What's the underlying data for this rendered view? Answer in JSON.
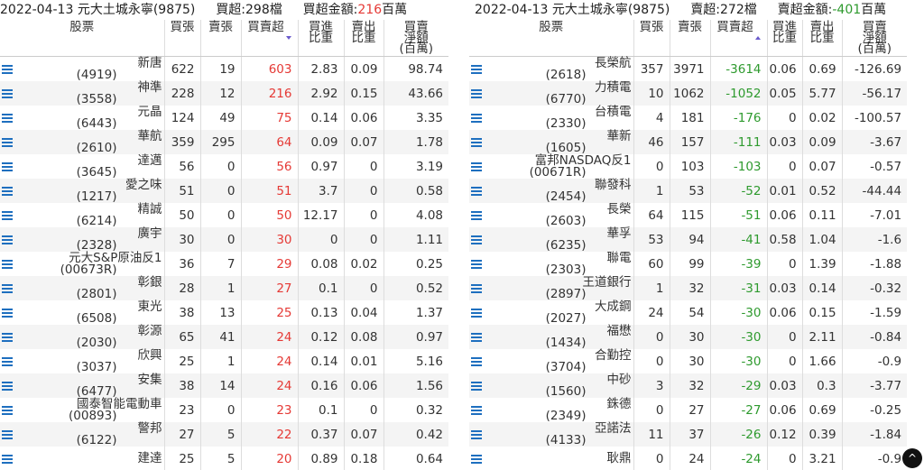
{
  "left": {
    "date": "2022-04-13",
    "broker": "元大土城永寧(9875)",
    "count_label": "買超:298檔",
    "amount_label": "買超金額:",
    "amount_value": "216",
    "amount_unit": "百萬",
    "headers": [
      "股票",
      "買張",
      "賣張",
      "買賣超",
      "買進\n比重",
      "賣出\n比重",
      "買賣\n淨額\n(百萬)"
    ],
    "rows": [
      {
        "name": "新唐",
        "code": "(4919)",
        "buy": "622",
        "sell": "19",
        "net": "603",
        "bp": "2.83",
        "sp": "0.09",
        "amt": "98.74"
      },
      {
        "name": "神準",
        "code": "(3558)",
        "buy": "228",
        "sell": "12",
        "net": "216",
        "bp": "2.92",
        "sp": "0.15",
        "amt": "43.66"
      },
      {
        "name": "元晶",
        "code": "(6443)",
        "buy": "124",
        "sell": "49",
        "net": "75",
        "bp": "0.14",
        "sp": "0.06",
        "amt": "3.35"
      },
      {
        "name": "華航",
        "code": "(2610)",
        "buy": "359",
        "sell": "295",
        "net": "64",
        "bp": "0.09",
        "sp": "0.07",
        "amt": "1.78"
      },
      {
        "name": "達邁",
        "code": "(3645)",
        "buy": "56",
        "sell": "0",
        "net": "56",
        "bp": "0.97",
        "sp": "0",
        "amt": "3.19"
      },
      {
        "name": "愛之味",
        "code": "(1217)",
        "buy": "51",
        "sell": "0",
        "net": "51",
        "bp": "3.7",
        "sp": "0",
        "amt": "0.58"
      },
      {
        "name": "精誠",
        "code": "(6214)",
        "buy": "50",
        "sell": "0",
        "net": "50",
        "bp": "12.17",
        "sp": "0",
        "amt": "4.08"
      },
      {
        "name": "廣宇",
        "code": "(2328)",
        "buy": "30",
        "sell": "0",
        "net": "30",
        "bp": "0",
        "sp": "0",
        "amt": "1.11"
      },
      {
        "name": "元大S&P原油反1",
        "code": "(00673R)",
        "buy": "36",
        "sell": "7",
        "net": "29",
        "bp": "0.08",
        "sp": "0.02",
        "amt": "0.25"
      },
      {
        "name": "彰銀",
        "code": "(2801)",
        "buy": "28",
        "sell": "1",
        "net": "27",
        "bp": "0.1",
        "sp": "0",
        "amt": "0.52"
      },
      {
        "name": "東光",
        "code": "(6508)",
        "buy": "38",
        "sell": "13",
        "net": "25",
        "bp": "0.13",
        "sp": "0.04",
        "amt": "1.37"
      },
      {
        "name": "彰源",
        "code": "(2030)",
        "buy": "65",
        "sell": "41",
        "net": "24",
        "bp": "0.12",
        "sp": "0.08",
        "amt": "0.97"
      },
      {
        "name": "欣興",
        "code": "(3037)",
        "buy": "25",
        "sell": "1",
        "net": "24",
        "bp": "0.14",
        "sp": "0.01",
        "amt": "5.16"
      },
      {
        "name": "安集",
        "code": "(6477)",
        "buy": "38",
        "sell": "14",
        "net": "24",
        "bp": "0.16",
        "sp": "0.06",
        "amt": "1.56"
      },
      {
        "name": "國泰智能電動車",
        "code": "(00893)",
        "buy": "23",
        "sell": "0",
        "net": "23",
        "bp": "0.1",
        "sp": "0",
        "amt": "0.32"
      },
      {
        "name": "警邦",
        "code": "(6122)",
        "buy": "27",
        "sell": "5",
        "net": "22",
        "bp": "0.37",
        "sp": "0.07",
        "amt": "0.42"
      },
      {
        "name": "建達",
        "code": "",
        "buy": "25",
        "sell": "5",
        "net": "20",
        "bp": "0.89",
        "sp": "0.18",
        "amt": "0.64"
      }
    ]
  },
  "right": {
    "date": "2022-04-13",
    "broker": "元大土城永寧(9875)",
    "count_label": "賣超:272檔",
    "amount_label": "賣超金額:",
    "amount_value": "-401",
    "amount_unit": "百萬",
    "headers": [
      "股票",
      "買張",
      "賣張",
      "買賣超",
      "買進\n比重",
      "賣出\n比重",
      "買賣\n淨額\n(百萬)"
    ],
    "rows": [
      {
        "name": "長榮航",
        "code": "(2618)",
        "buy": "357",
        "sell": "3971",
        "net": "-3614",
        "bp": "0.06",
        "sp": "0.69",
        "amt": "-126.69"
      },
      {
        "name": "力積電",
        "code": "(6770)",
        "buy": "10",
        "sell": "1062",
        "net": "-1052",
        "bp": "0.05",
        "sp": "5.77",
        "amt": "-56.17"
      },
      {
        "name": "台積電",
        "code": "(2330)",
        "buy": "4",
        "sell": "181",
        "net": "-176",
        "bp": "0",
        "sp": "0.02",
        "amt": "-100.57"
      },
      {
        "name": "華新",
        "code": "(1605)",
        "buy": "46",
        "sell": "157",
        "net": "-111",
        "bp": "0.03",
        "sp": "0.09",
        "amt": "-3.67"
      },
      {
        "name": "富邦NASDAQ反1",
        "code": "(00671R)",
        "buy": "0",
        "sell": "103",
        "net": "-103",
        "bp": "0",
        "sp": "0.07",
        "amt": "-0.57"
      },
      {
        "name": "聯發科",
        "code": "(2454)",
        "buy": "1",
        "sell": "53",
        "net": "-52",
        "bp": "0.01",
        "sp": "0.52",
        "amt": "-44.44"
      },
      {
        "name": "長榮",
        "code": "(2603)",
        "buy": "64",
        "sell": "115",
        "net": "-51",
        "bp": "0.06",
        "sp": "0.11",
        "amt": "-7.01"
      },
      {
        "name": "華孚",
        "code": "(6235)",
        "buy": "53",
        "sell": "94",
        "net": "-41",
        "bp": "0.58",
        "sp": "1.04",
        "amt": "-1.6"
      },
      {
        "name": "聯電",
        "code": "(2303)",
        "buy": "60",
        "sell": "99",
        "net": "-39",
        "bp": "0",
        "sp": "1.39",
        "amt": "-1.88"
      },
      {
        "name": "王道銀行",
        "code": "(2897)",
        "buy": "1",
        "sell": "32",
        "net": "-31",
        "bp": "0.03",
        "sp": "0.14",
        "amt": "-0.32"
      },
      {
        "name": "大成鋼",
        "code": "(2027)",
        "buy": "24",
        "sell": "54",
        "net": "-30",
        "bp": "0.06",
        "sp": "0.15",
        "amt": "-1.59"
      },
      {
        "name": "福懋",
        "code": "(1434)",
        "buy": "0",
        "sell": "30",
        "net": "-30",
        "bp": "0",
        "sp": "2.11",
        "amt": "-0.84"
      },
      {
        "name": "合勤控",
        "code": "(3704)",
        "buy": "0",
        "sell": "30",
        "net": "-30",
        "bp": "0",
        "sp": "1.66",
        "amt": "-0.9"
      },
      {
        "name": "中砂",
        "code": "(1560)",
        "buy": "3",
        "sell": "32",
        "net": "-29",
        "bp": "0.03",
        "sp": "0.3",
        "amt": "-3.77"
      },
      {
        "name": "銖德",
        "code": "(2349)",
        "buy": "0",
        "sell": "27",
        "net": "-27",
        "bp": "0.06",
        "sp": "0.69",
        "amt": "-0.25"
      },
      {
        "name": "亞諾法",
        "code": "(4133)",
        "buy": "11",
        "sell": "37",
        "net": "-26",
        "bp": "0.12",
        "sp": "0.39",
        "amt": "-1.84"
      },
      {
        "name": "耿鼎",
        "code": "",
        "buy": "0",
        "sell": "24",
        "net": "-24",
        "bp": "0",
        "sp": "3.21",
        "amt": "-0.9"
      }
    ]
  },
  "fab_label": "^"
}
